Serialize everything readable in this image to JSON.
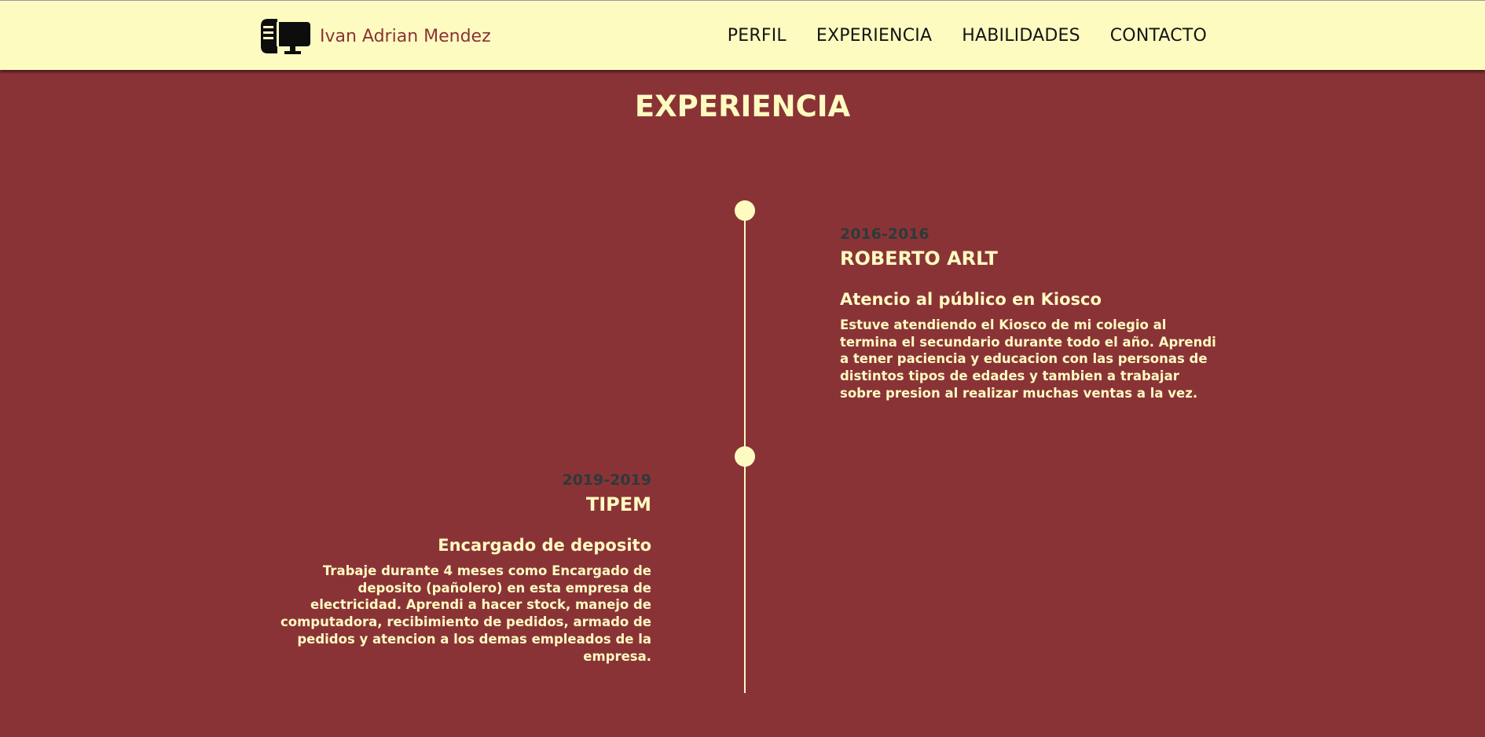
{
  "header": {
    "brand_name": "Ivan Adrian Mendez",
    "logo_icon": "computer-monitor-icon",
    "nav": [
      {
        "label": "PERFIL"
      },
      {
        "label": "EXPERIENCIA"
      },
      {
        "label": "HABILIDADES"
      },
      {
        "label": "CONTACTO"
      }
    ]
  },
  "experience": {
    "title": "EXPERIENCIA",
    "entries": [
      {
        "date": "2016-2016",
        "company": "ROBERTO ARLT",
        "role": "Atencio al público en Kiosco",
        "description": "Estuve atendiendo el Kiosco de mi colegio al termina el secundario durante todo el año. Aprendi a tener paciencia y educacion con las personas de distintos tipos de edades y tambien a trabajar sobre presion al realizar muchas ventas a la vez."
      },
      {
        "date": "2019-2019",
        "company": "TIPEM",
        "role": "Encargado de deposito",
        "description": "Trabaje durante 4 meses como Encargado de deposito (pañolero) en esta empresa de electricidad. Aprendi a hacer stock, manejo de computadora, recibimiento de pedidos, armado de pedidos y atencion a los demas empleados de la empresa."
      }
    ]
  },
  "colors": {
    "background": "#8a3337",
    "navbar": "#fefbc1",
    "accent_text": "#fefbc1",
    "date_text": "#2e3a3a",
    "nav_text": "#141414"
  }
}
